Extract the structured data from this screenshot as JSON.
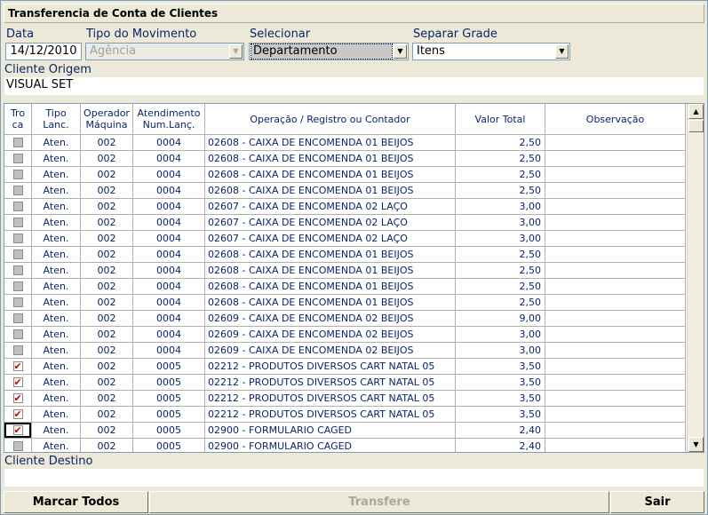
{
  "window": {
    "title": "Transferencia de Conta de Clientes"
  },
  "filters": {
    "data_label": "Data",
    "data_value": "14/12/2010",
    "tipo_label": "Tipo do Movimento",
    "tipo_value": "Agência",
    "selecionar_label": "Selecionar",
    "selecionar_value": "Departamento",
    "separar_label": "Separar Grade",
    "separar_value": "Itens",
    "cliente_origem_label": "Cliente Origem",
    "cliente_origem_value": "VISUAL SET",
    "cliente_destino_label": "Cliente Destino",
    "cliente_destino_value": ""
  },
  "grid": {
    "headers": {
      "troca": "Tro ca",
      "tipo": "Tipo Lanc.",
      "operador": "Operador Máquina",
      "atendimento": "Atendimento Num.Lanç.",
      "operacao": "Operação / Registro ou Contador",
      "valor": "Valor Total",
      "obs": "Observação"
    },
    "rows": [
      {
        "checked": false,
        "tipo": "Aten.",
        "oper": "002",
        "aten": "0004",
        "op": "02608 - CAIXA DE ENCOMENDA 01 BEIJOS",
        "valor": "2,50",
        "obs": ""
      },
      {
        "checked": false,
        "tipo": "Aten.",
        "oper": "002",
        "aten": "0004",
        "op": "02608 - CAIXA DE ENCOMENDA 01 BEIJOS",
        "valor": "2,50",
        "obs": ""
      },
      {
        "checked": false,
        "tipo": "Aten.",
        "oper": "002",
        "aten": "0004",
        "op": "02608 - CAIXA DE ENCOMENDA 01 BEIJOS",
        "valor": "2,50",
        "obs": ""
      },
      {
        "checked": false,
        "tipo": "Aten.",
        "oper": "002",
        "aten": "0004",
        "op": "02608 - CAIXA DE ENCOMENDA 01 BEIJOS",
        "valor": "2,50",
        "obs": ""
      },
      {
        "checked": false,
        "tipo": "Aten.",
        "oper": "002",
        "aten": "0004",
        "op": "02607 - CAIXA DE ENCOMENDA 02 LAÇO",
        "valor": "3,00",
        "obs": ""
      },
      {
        "checked": false,
        "tipo": "Aten.",
        "oper": "002",
        "aten": "0004",
        "op": "02607 - CAIXA DE ENCOMENDA 02 LAÇO",
        "valor": "3,00",
        "obs": ""
      },
      {
        "checked": false,
        "tipo": "Aten.",
        "oper": "002",
        "aten": "0004",
        "op": "02607 - CAIXA DE ENCOMENDA 02 LAÇO",
        "valor": "3,00",
        "obs": ""
      },
      {
        "checked": false,
        "tipo": "Aten.",
        "oper": "002",
        "aten": "0004",
        "op": "02608 - CAIXA DE ENCOMENDA 01 BEIJOS",
        "valor": "2,50",
        "obs": ""
      },
      {
        "checked": false,
        "tipo": "Aten.",
        "oper": "002",
        "aten": "0004",
        "op": "02608 - CAIXA DE ENCOMENDA 01 BEIJOS",
        "valor": "2,50",
        "obs": ""
      },
      {
        "checked": false,
        "tipo": "Aten.",
        "oper": "002",
        "aten": "0004",
        "op": "02608 - CAIXA DE ENCOMENDA 01 BEIJOS",
        "valor": "2,50",
        "obs": ""
      },
      {
        "checked": false,
        "tipo": "Aten.",
        "oper": "002",
        "aten": "0004",
        "op": "02608 - CAIXA DE ENCOMENDA 01 BEIJOS",
        "valor": "2,50",
        "obs": ""
      },
      {
        "checked": false,
        "tipo": "Aten.",
        "oper": "002",
        "aten": "0004",
        "op": "02609 - CAIXA DE ENCOMENDA 02 BEIJOS",
        "valor": "9,00",
        "obs": ""
      },
      {
        "checked": false,
        "tipo": "Aten.",
        "oper": "002",
        "aten": "0004",
        "op": "02609 - CAIXA DE ENCOMENDA 02 BEIJOS",
        "valor": "3,00",
        "obs": ""
      },
      {
        "checked": false,
        "tipo": "Aten.",
        "oper": "002",
        "aten": "0004",
        "op": "02609 - CAIXA DE ENCOMENDA 02 BEIJOS",
        "valor": "3,00",
        "obs": ""
      },
      {
        "checked": true,
        "tipo": "Aten.",
        "oper": "002",
        "aten": "0005",
        "op": "02212 - PRODUTOS DIVERSOS CART NATAL 05",
        "valor": "3,50",
        "obs": ""
      },
      {
        "checked": true,
        "tipo": "Aten.",
        "oper": "002",
        "aten": "0005",
        "op": "02212 - PRODUTOS DIVERSOS CART NATAL 05",
        "valor": "3,50",
        "obs": ""
      },
      {
        "checked": true,
        "tipo": "Aten.",
        "oper": "002",
        "aten": "0005",
        "op": "02212 - PRODUTOS DIVERSOS CART NATAL 05",
        "valor": "3,50",
        "obs": ""
      },
      {
        "checked": true,
        "tipo": "Aten.",
        "oper": "002",
        "aten": "0005",
        "op": "02212 - PRODUTOS DIVERSOS CART NATAL 05",
        "valor": "3,50",
        "obs": ""
      },
      {
        "checked": true,
        "tipo": "Aten.",
        "oper": "002",
        "aten": "0005",
        "op": "02900 - FORMULARIO CAGED",
        "valor": "2,40",
        "obs": "",
        "focused": true
      },
      {
        "checked": false,
        "tipo": "Aten.",
        "oper": "002",
        "aten": "0005",
        "op": "02900 - FORMULARIO CAGED",
        "valor": "2,40",
        "obs": ""
      }
    ]
  },
  "buttons": {
    "marcar_todos": "Marcar Todos",
    "transfere": "Transfere",
    "sair": "Sair"
  },
  "icons": {
    "dropdown": "chevron-down-icon",
    "scroll_up": "scroll-up-icon",
    "scroll_down": "scroll-down-icon",
    "checkmark": "checkmark-icon"
  }
}
